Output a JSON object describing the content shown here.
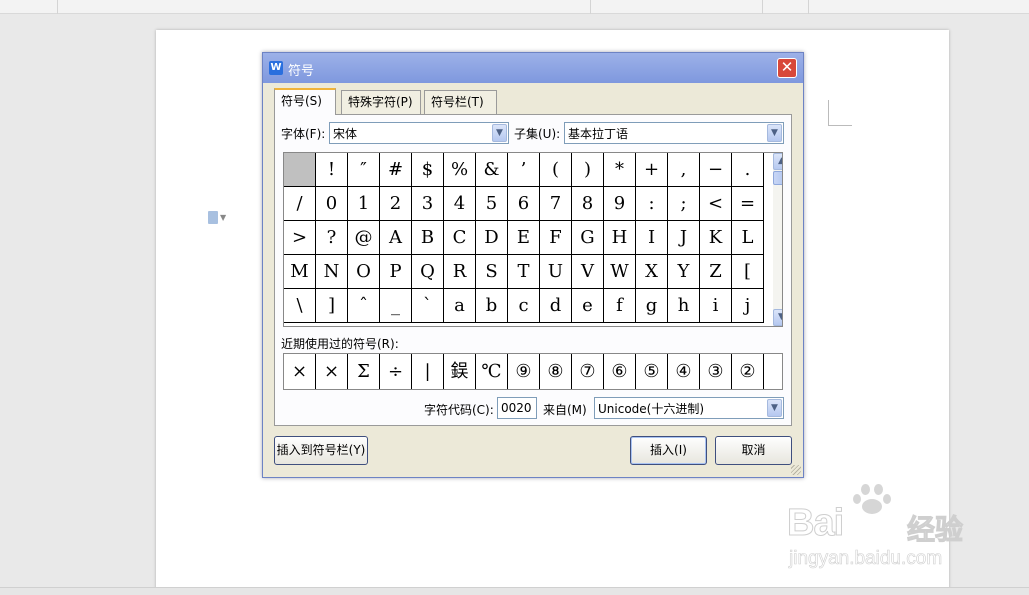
{
  "dialog": {
    "title": "符号",
    "app_icon_letter": "W",
    "close_symbol": "✕",
    "tabs": [
      {
        "label": "符号(S)",
        "active": true
      },
      {
        "label": "特殊字符(P)",
        "active": false
      },
      {
        "label": "符号栏(T)",
        "active": false
      }
    ],
    "font_label": "字体(F):",
    "font_value": "宋体",
    "subset_label": "子集(U):",
    "subset_value": "基本拉丁语",
    "symbol_grid": [
      [
        "",
        "!",
        "″",
        "#",
        "$",
        "%",
        "&",
        "’",
        "(",
        ")",
        "*",
        "+",
        ",",
        "−",
        "."
      ],
      [
        "/",
        "0",
        "1",
        "2",
        "3",
        "4",
        "5",
        "6",
        "7",
        "8",
        "9",
        ":",
        ";",
        "<",
        "="
      ],
      [
        ">",
        "?",
        "@",
        "A",
        "B",
        "C",
        "D",
        "E",
        "F",
        "G",
        "H",
        "I",
        "J",
        "K",
        "L"
      ],
      [
        "M",
        "N",
        "O",
        "P",
        "Q",
        "R",
        "S",
        "T",
        "U",
        "V",
        "W",
        "X",
        "Y",
        "Z",
        "["
      ],
      [
        "\\",
        "]",
        "ˆ",
        "_",
        "`",
        "a",
        "b",
        "c",
        "d",
        "e",
        "f",
        "g",
        "h",
        "i",
        "j"
      ]
    ],
    "selected_cell": "space",
    "recent_label": "近期使用过的符号(R):",
    "recent_symbols": [
      "×",
      "×",
      "Σ",
      "÷",
      "|",
      "鋘",
      "℃",
      "⑨",
      "⑧",
      "⑦",
      "⑥",
      "⑤",
      "④",
      "③",
      "②"
    ],
    "char_code_label": "字符代码(C):",
    "char_code_value": "0020",
    "from_label": "来自(M)",
    "from_value": "Unicode(十六进制)",
    "insert_to_bar_button": "插入到符号栏(Y)",
    "insert_button": "插入(I)",
    "cancel_button": "取消"
  },
  "watermark": {
    "brand": "Bai",
    "brand_cn": "经验",
    "url": "jingyan.baidu.com"
  },
  "colors": {
    "titlebar": "#8aa1e2",
    "close": "#d8483a",
    "dialog_bg": "#ece9d8",
    "active_tab_accent": "#f0b33a"
  }
}
